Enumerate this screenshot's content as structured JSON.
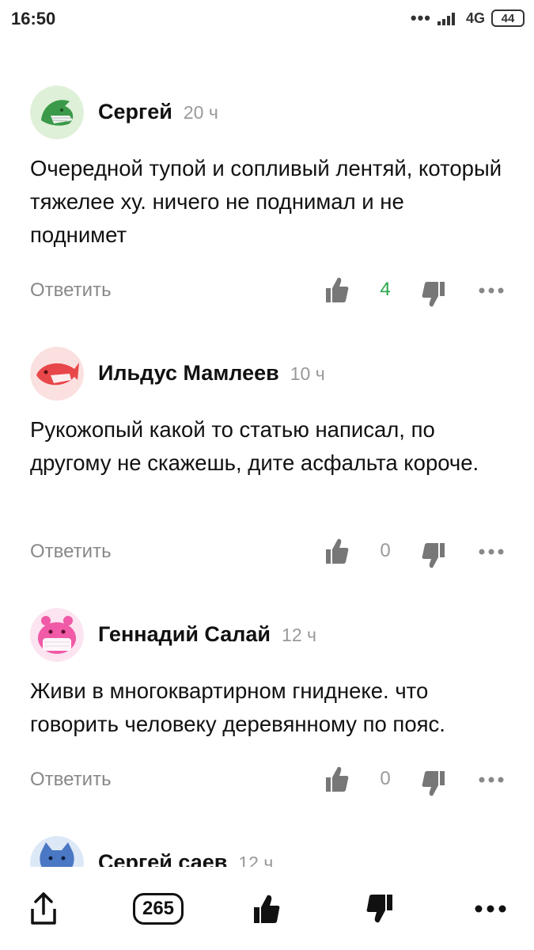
{
  "status_bar": {
    "time": "16:50",
    "dots": "•••",
    "network": "4G",
    "battery": "44"
  },
  "comments": [
    {
      "author": "Сергей",
      "time": "20 ч",
      "text": "Очередной тупой и сопливый лентяй, который тяжелее ху. ничего не поднимал и не поднимет",
      "reply_label": "Ответить",
      "likes": "4",
      "avatar": "green-dolphin-mask-avatar"
    },
    {
      "author": "Ильдус Мамлеев",
      "time": "10 ч",
      "text": "Рукожопый какой то статью написал, по другому не скажешь, дите асфальта короче.",
      "reply_label": "Ответить",
      "likes": "0",
      "avatar": "red-fish-mask-avatar"
    },
    {
      "author": "Геннадий Салай",
      "time": "12 ч",
      "text": "Живи в многоквартирном гниднеке. что говорить человеку деревянному по пояс.",
      "reply_label": "Ответить",
      "likes": "0",
      "avatar": "pink-hippo-mask-avatar"
    },
    {
      "author": "Сергей саев",
      "time": "12 ч",
      "avatar": "blue-cat-mask-avatar"
    }
  ],
  "bottom_bar": {
    "comment_count": "265"
  },
  "colors": {
    "accent_positive": "#2aa84a",
    "muted": "#888888"
  },
  "icons": [
    "share-icon",
    "thumbs-up-icon",
    "thumbs-down-icon",
    "more-icon"
  ]
}
